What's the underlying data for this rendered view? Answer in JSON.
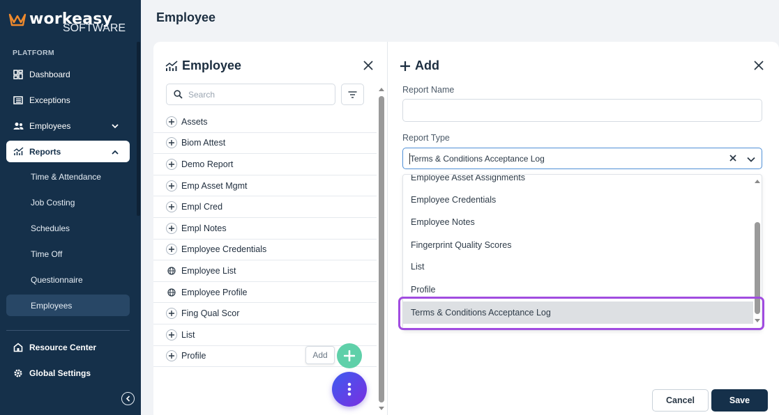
{
  "brand": {
    "name": "workeasy",
    "tagline": "SOFTWARE"
  },
  "sidebar": {
    "section_label": "PLATFORM",
    "items": [
      {
        "label": "Dashboard",
        "icon": "dashboard-icon"
      },
      {
        "label": "Exceptions",
        "icon": "list-icon"
      },
      {
        "label": "Employees",
        "icon": "people-icon",
        "expandable": true
      },
      {
        "label": "Reports",
        "icon": "chart-icon",
        "active": true,
        "expanded": true
      }
    ],
    "report_subitems": [
      "Time & Attendance",
      "Job Costing",
      "Schedules",
      "Time Off",
      "Questionnaire",
      "Employees"
    ],
    "selected_subitem": "Employees",
    "footer_items": [
      {
        "label": "Resource Center",
        "icon": "home-icon"
      },
      {
        "label": "Global Settings",
        "icon": "gear-icon"
      }
    ]
  },
  "header": {
    "title": "Employee"
  },
  "left_panel": {
    "title": "Employee",
    "search_placeholder": "Search",
    "reports": [
      {
        "label": "Assets",
        "icon": "plus"
      },
      {
        "label": "Biom Attest",
        "icon": "plus"
      },
      {
        "label": "Demo Report",
        "icon": "plus"
      },
      {
        "label": "Emp Asset Mgmt",
        "icon": "plus"
      },
      {
        "label": "Empl Cred",
        "icon": "plus"
      },
      {
        "label": "Empl Notes",
        "icon": "plus"
      },
      {
        "label": "Employee Credentials",
        "icon": "plus"
      },
      {
        "label": "Employee List",
        "icon": "globe"
      },
      {
        "label": "Employee Profile",
        "icon": "globe"
      },
      {
        "label": "Fing Qual Scor",
        "icon": "plus"
      },
      {
        "label": "List",
        "icon": "plus"
      },
      {
        "label": "Profile",
        "icon": "plus"
      }
    ],
    "add_tooltip": "Add"
  },
  "right_panel": {
    "title": "Add",
    "report_name_label": "Report Name",
    "report_name_value": "",
    "report_type_label": "Report Type",
    "report_type_value": "Terms & Conditions Acceptance Log",
    "options": [
      "Employee Asset Assignments",
      "Employee Credentials",
      "Employee Notes",
      "Fingerprint Quality Scores",
      "List",
      "Profile",
      "Terms & Conditions Acceptance Log"
    ],
    "highlighted_option": "Terms & Conditions Acceptance Log",
    "cancel_label": "Cancel",
    "save_label": "Save"
  },
  "colors": {
    "sidebar_bg": "#15304a",
    "accent_purple": "#a14ce0",
    "fab_green": "#5fd0a9",
    "save_bg": "#15304a"
  }
}
